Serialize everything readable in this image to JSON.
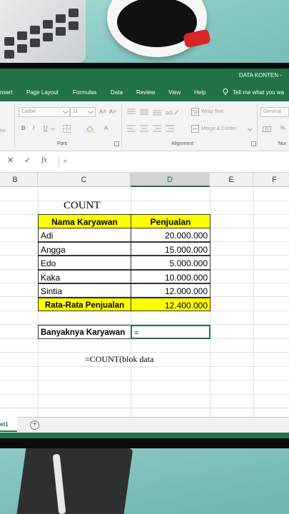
{
  "window": {
    "doc_title": "DATA KONTEN  -"
  },
  "ribbon_tabs": [
    "nsert",
    "Page Layout",
    "Formulas",
    "Data",
    "Review",
    "View",
    "Help"
  ],
  "tell_me": "Tell me what you wa",
  "ribbon": {
    "font_name": "Calibri",
    "font_size": "11",
    "grow_font": "A˄",
    "shrink_font": "A˅",
    "bold": "B",
    "italic": "I",
    "underline": "U",
    "font_color": "A",
    "wrap_text": "Wrap Text",
    "merge_center": "Merge & Center",
    "number_format": "General",
    "percent": "%",
    "left_fragment": "ter",
    "font_group": "Font",
    "alignment_group": "Alignment",
    "number_group": "Nur"
  },
  "formula_bar": {
    "cancel": "✕",
    "enter": "✓",
    "fx": "fx",
    "content": "="
  },
  "columns": [
    "B",
    "C",
    "D",
    "E",
    "F"
  ],
  "active_column": "D",
  "sheet": {
    "title": "COUNT",
    "header_name": "Nama Karyawan",
    "header_sales": "Penjualan",
    "rows": [
      {
        "name": "Adi",
        "sales": "20.000.000"
      },
      {
        "name": "Angga",
        "sales": "15.000.000"
      },
      {
        "name": "Edo",
        "sales": "5.000.000"
      },
      {
        "name": "Kaka",
        "sales": "10.000.000"
      },
      {
        "name": "Sintia",
        "sales": "12.000.000"
      }
    ],
    "avg_label": "Rata-Rata Penjualan",
    "avg_value": "12.400.000",
    "count_label": "Banyaknya Karyawan",
    "count_value": "=",
    "note": "=COUNT(blok data"
  },
  "sheet_tab": "et1",
  "add_sheet": "+",
  "colors": {
    "excel_green": "#217346",
    "highlight": "#ffff00"
  }
}
